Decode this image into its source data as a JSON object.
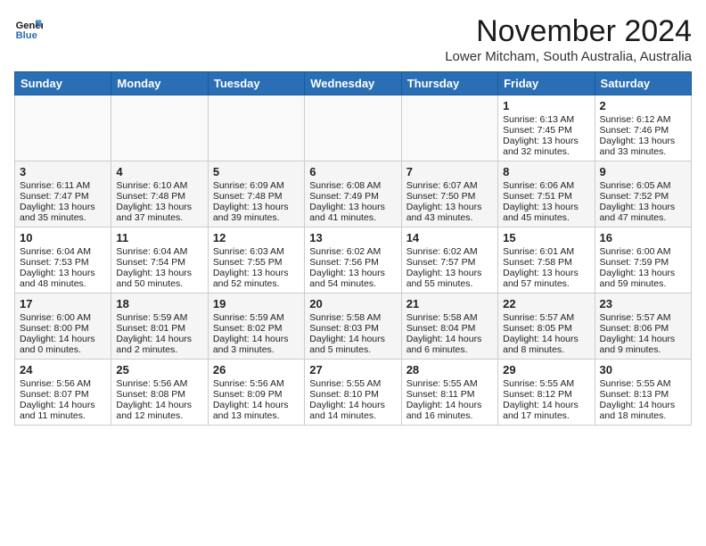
{
  "logo": {
    "line1": "General",
    "line2": "Blue"
  },
  "title": "November 2024",
  "location": "Lower Mitcham, South Australia, Australia",
  "days_of_week": [
    "Sunday",
    "Monday",
    "Tuesday",
    "Wednesday",
    "Thursday",
    "Friday",
    "Saturday"
  ],
  "weeks": [
    [
      {
        "day": "",
        "data": ""
      },
      {
        "day": "",
        "data": ""
      },
      {
        "day": "",
        "data": ""
      },
      {
        "day": "",
        "data": ""
      },
      {
        "day": "",
        "data": ""
      },
      {
        "day": "1",
        "data": "Sunrise: 6:13 AM\nSunset: 7:45 PM\nDaylight: 13 hours\nand 32 minutes."
      },
      {
        "day": "2",
        "data": "Sunrise: 6:12 AM\nSunset: 7:46 PM\nDaylight: 13 hours\nand 33 minutes."
      }
    ],
    [
      {
        "day": "3",
        "data": "Sunrise: 6:11 AM\nSunset: 7:47 PM\nDaylight: 13 hours\nand 35 minutes."
      },
      {
        "day": "4",
        "data": "Sunrise: 6:10 AM\nSunset: 7:48 PM\nDaylight: 13 hours\nand 37 minutes."
      },
      {
        "day": "5",
        "data": "Sunrise: 6:09 AM\nSunset: 7:48 PM\nDaylight: 13 hours\nand 39 minutes."
      },
      {
        "day": "6",
        "data": "Sunrise: 6:08 AM\nSunset: 7:49 PM\nDaylight: 13 hours\nand 41 minutes."
      },
      {
        "day": "7",
        "data": "Sunrise: 6:07 AM\nSunset: 7:50 PM\nDaylight: 13 hours\nand 43 minutes."
      },
      {
        "day": "8",
        "data": "Sunrise: 6:06 AM\nSunset: 7:51 PM\nDaylight: 13 hours\nand 45 minutes."
      },
      {
        "day": "9",
        "data": "Sunrise: 6:05 AM\nSunset: 7:52 PM\nDaylight: 13 hours\nand 47 minutes."
      }
    ],
    [
      {
        "day": "10",
        "data": "Sunrise: 6:04 AM\nSunset: 7:53 PM\nDaylight: 13 hours\nand 48 minutes."
      },
      {
        "day": "11",
        "data": "Sunrise: 6:04 AM\nSunset: 7:54 PM\nDaylight: 13 hours\nand 50 minutes."
      },
      {
        "day": "12",
        "data": "Sunrise: 6:03 AM\nSunset: 7:55 PM\nDaylight: 13 hours\nand 52 minutes."
      },
      {
        "day": "13",
        "data": "Sunrise: 6:02 AM\nSunset: 7:56 PM\nDaylight: 13 hours\nand 54 minutes."
      },
      {
        "day": "14",
        "data": "Sunrise: 6:02 AM\nSunset: 7:57 PM\nDaylight: 13 hours\nand 55 minutes."
      },
      {
        "day": "15",
        "data": "Sunrise: 6:01 AM\nSunset: 7:58 PM\nDaylight: 13 hours\nand 57 minutes."
      },
      {
        "day": "16",
        "data": "Sunrise: 6:00 AM\nSunset: 7:59 PM\nDaylight: 13 hours\nand 59 minutes."
      }
    ],
    [
      {
        "day": "17",
        "data": "Sunrise: 6:00 AM\nSunset: 8:00 PM\nDaylight: 14 hours\nand 0 minutes."
      },
      {
        "day": "18",
        "data": "Sunrise: 5:59 AM\nSunset: 8:01 PM\nDaylight: 14 hours\nand 2 minutes."
      },
      {
        "day": "19",
        "data": "Sunrise: 5:59 AM\nSunset: 8:02 PM\nDaylight: 14 hours\nand 3 minutes."
      },
      {
        "day": "20",
        "data": "Sunrise: 5:58 AM\nSunset: 8:03 PM\nDaylight: 14 hours\nand 5 minutes."
      },
      {
        "day": "21",
        "data": "Sunrise: 5:58 AM\nSunset: 8:04 PM\nDaylight: 14 hours\nand 6 minutes."
      },
      {
        "day": "22",
        "data": "Sunrise: 5:57 AM\nSunset: 8:05 PM\nDaylight: 14 hours\nand 8 minutes."
      },
      {
        "day": "23",
        "data": "Sunrise: 5:57 AM\nSunset: 8:06 PM\nDaylight: 14 hours\nand 9 minutes."
      }
    ],
    [
      {
        "day": "24",
        "data": "Sunrise: 5:56 AM\nSunset: 8:07 PM\nDaylight: 14 hours\nand 11 minutes."
      },
      {
        "day": "25",
        "data": "Sunrise: 5:56 AM\nSunset: 8:08 PM\nDaylight: 14 hours\nand 12 minutes."
      },
      {
        "day": "26",
        "data": "Sunrise: 5:56 AM\nSunset: 8:09 PM\nDaylight: 14 hours\nand 13 minutes."
      },
      {
        "day": "27",
        "data": "Sunrise: 5:55 AM\nSunset: 8:10 PM\nDaylight: 14 hours\nand 14 minutes."
      },
      {
        "day": "28",
        "data": "Sunrise: 5:55 AM\nSunset: 8:11 PM\nDaylight: 14 hours\nand 16 minutes."
      },
      {
        "day": "29",
        "data": "Sunrise: 5:55 AM\nSunset: 8:12 PM\nDaylight: 14 hours\nand 17 minutes."
      },
      {
        "day": "30",
        "data": "Sunrise: 5:55 AM\nSunset: 8:13 PM\nDaylight: 14 hours\nand 18 minutes."
      }
    ]
  ]
}
